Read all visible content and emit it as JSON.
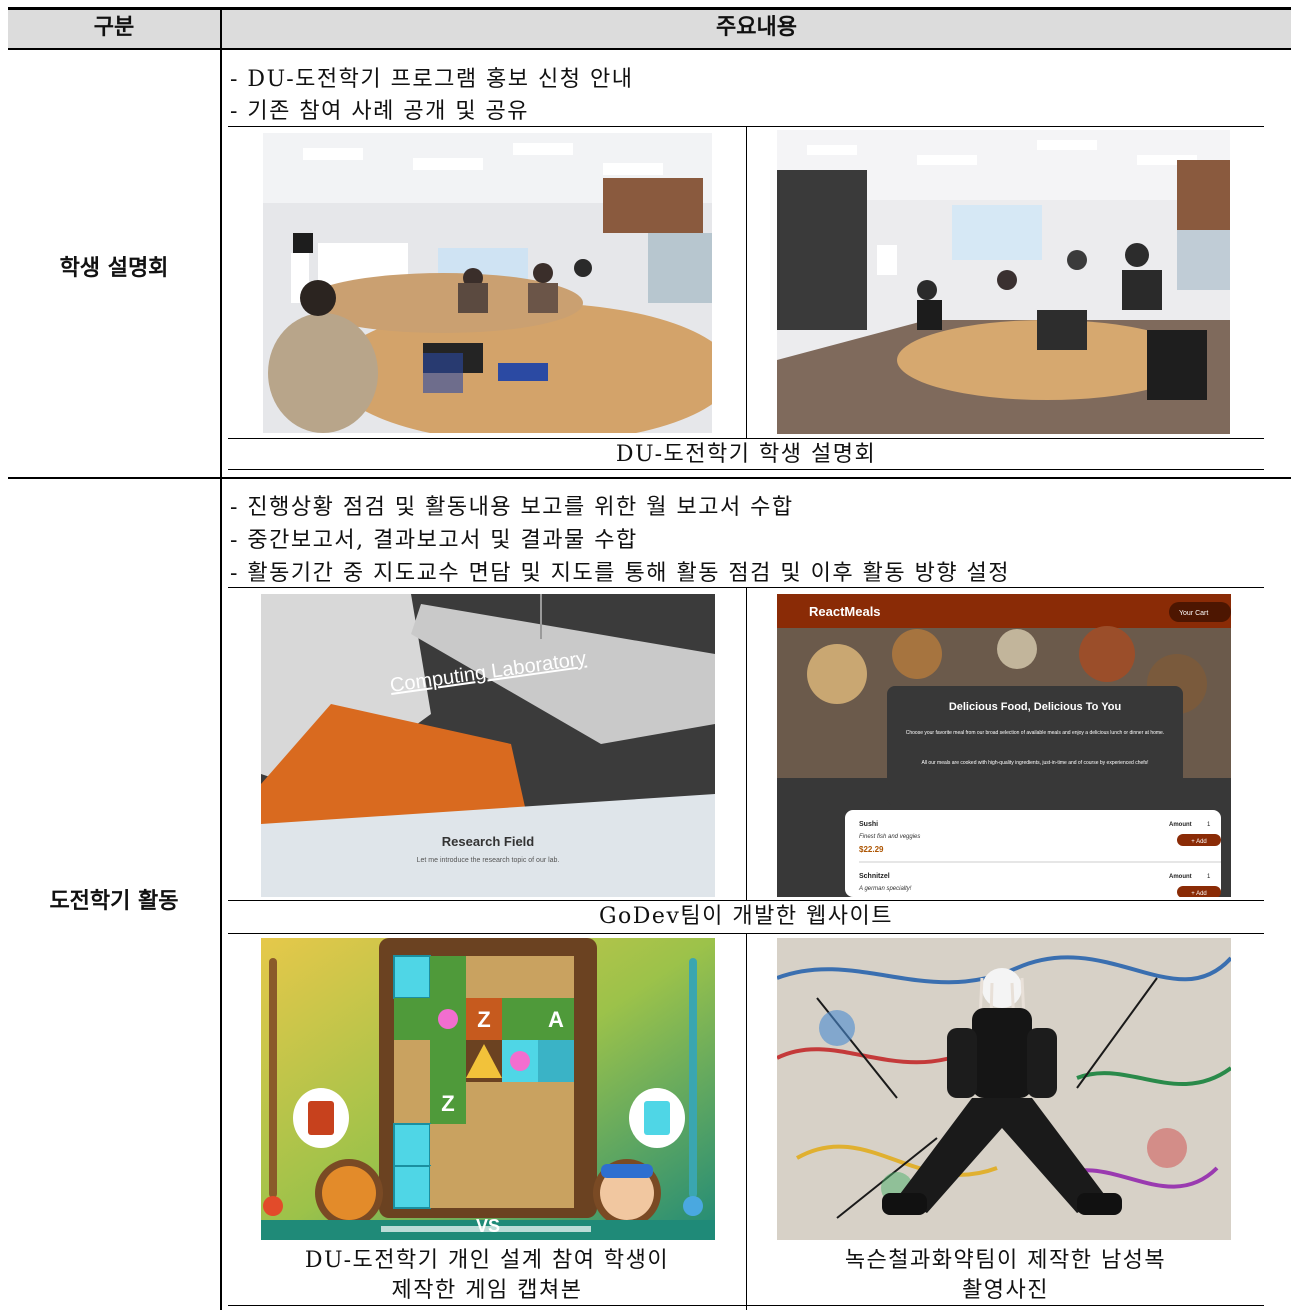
{
  "header": {
    "col1": "구분",
    "col2": "주요내용"
  },
  "section1": {
    "label": "학생 설명회",
    "bullets": [
      "- DU-도전학기 프로그램 홍보 신청 안내",
      "- 기존 참여 사례 공개 및 공유"
    ],
    "caption": "DU-도전학기 학생 설명회"
  },
  "section2": {
    "label": "도전학기 활동",
    "bullets": [
      "- 진행상황 점검 및 활동내용 보고를 위한 월 보고서 수합",
      "- 중간보고서, 결과보고서 및 결과물 수합",
      "- 활동기간 중 지도교수 면담 및 지도를 통해 활동 점검 및 이후 활동 방향 설정"
    ],
    "website_caption": "GoDev팀이 개발한 웹사이트",
    "game_caption_line1": "DU-도전학기 개인 설계 참여 학생이",
    "game_caption_line2": "제작한 게임 캡쳐본",
    "fashion_caption_line1": "녹슨철과화약팀이 제작한 남성복",
    "fashion_caption_line2": "촬영사진"
  },
  "lab_site": {
    "title": "Computing Laboratory",
    "section": "Research Field",
    "subtitle": "Let me introduce the research topic of our lab."
  },
  "meals_site": {
    "brand": "ReactMeals",
    "cart": "Your Cart",
    "hero_title": "Delicious Food, Delicious To You",
    "hero_p1": "Choose your favorite meal from our broad selection of available meals and enjoy a delicious lunch or dinner at home.",
    "hero_p2": "All our meals are cooked with high-quality ingredients, just-in-time and of course by experienced chefs!",
    "items": [
      {
        "name": "Sushi",
        "desc": "Finest fish and veggies",
        "price": "$22.29",
        "amount_label": "Amount",
        "amount": "1",
        "add": "+ Add"
      },
      {
        "name": "Schnitzel",
        "desc": "A german specialty!",
        "price": "",
        "amount_label": "Amount",
        "amount": "1",
        "add": "+ Add"
      }
    ]
  },
  "game": {
    "tile_letters": [
      "Z",
      "A",
      "Z"
    ],
    "vs": "VS"
  }
}
